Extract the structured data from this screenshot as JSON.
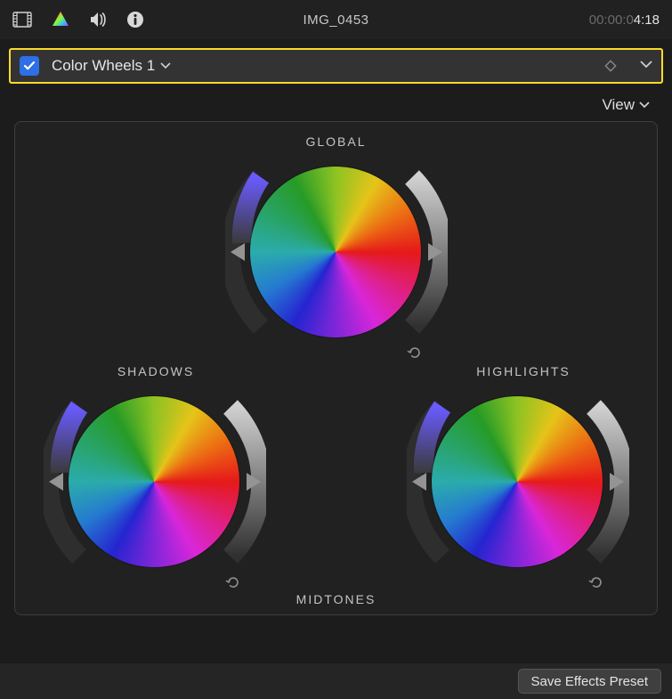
{
  "header": {
    "title": "IMG_0453",
    "timecode_prefix": "00:00:0",
    "timecode_highlight": "4:18"
  },
  "effect_row": {
    "enabled": true,
    "name": "Color Wheels 1"
  },
  "view_menu": {
    "label": "View"
  },
  "wheels": {
    "global": {
      "label": "GLOBAL"
    },
    "shadows": {
      "label": "SHADOWS"
    },
    "highlights": {
      "label": "HIGHLIGHTS"
    },
    "midtones": {
      "label": "MIDTONES"
    }
  },
  "bottom": {
    "save_preset_label": "Save Effects Preset"
  },
  "colors": {
    "accent_blue": "#2d6fe4",
    "highlight_border": "#fbdb2b"
  }
}
